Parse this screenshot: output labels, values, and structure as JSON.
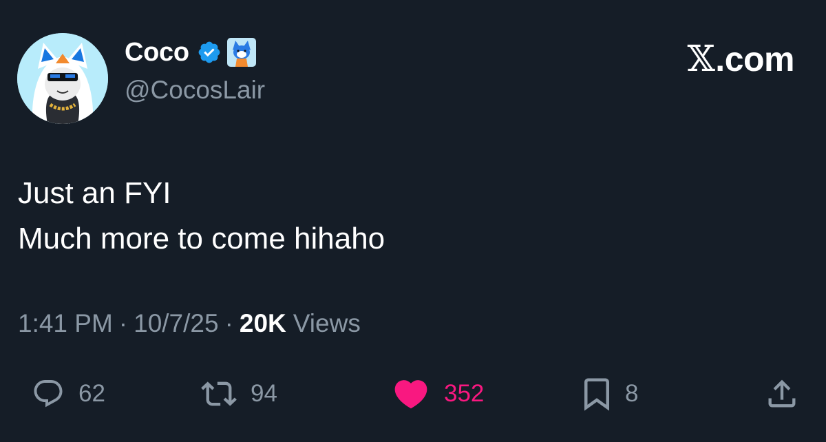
{
  "author": {
    "display_name": "Coco",
    "handle": "@CocosLair",
    "verified_icon": "verified-badge-icon",
    "affiliate_icon": "fox-affiliate-badge-icon"
  },
  "brand": {
    "x_glyph": "𝕏",
    "suffix": ".com"
  },
  "tweet": {
    "line1": "Just an FYI",
    "line2": "Much more to come hihaho"
  },
  "meta": {
    "time": "1:41 PM",
    "sep1": "·",
    "date": "10/7/25",
    "sep2": "·",
    "views_count": "20K",
    "views_label": "Views"
  },
  "actions": {
    "replies": "62",
    "reposts": "94",
    "likes": "352",
    "bookmarks": "8"
  },
  "colors": {
    "background": "#151d27",
    "text_primary": "#ffffff",
    "text_secondary": "#8b98a5",
    "verified": "#1d9bf0",
    "like": "#f91880"
  }
}
